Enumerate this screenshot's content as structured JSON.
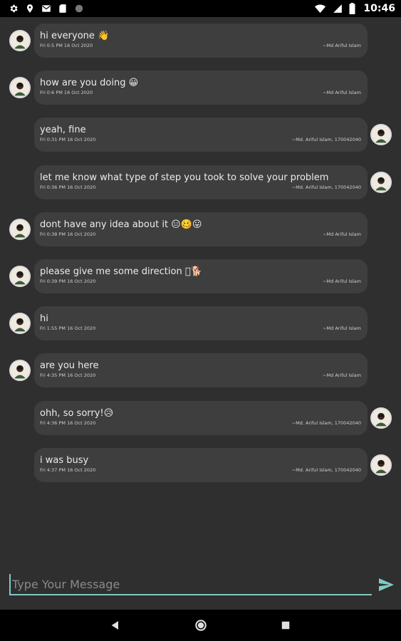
{
  "status_bar": {
    "time": "10:46",
    "left_icons": [
      "gear-icon",
      "location-pin-icon",
      "mail-icon",
      "sd-card-icon",
      "circle-icon"
    ],
    "right_icons": [
      "wifi-icon",
      "signal-icon",
      "battery-icon"
    ]
  },
  "messages": [
    {
      "side": "left",
      "text": "hi everyone 👋",
      "time": "Fri 0:5 PM 16 Oct 2020",
      "sender": "~Md Ariful Islam"
    },
    {
      "side": "left",
      "text": "how are you doing 😀",
      "time": "Fri 0:6 PM 16 Oct 2020",
      "sender": "~Md Ariful Islam"
    },
    {
      "side": "right",
      "text": "yeah, fine",
      "time": "Fri 0:31 PM 16 Oct 2020",
      "sender": "~Md. Ariful Islam, 170042040"
    },
    {
      "side": "right",
      "text": "let me know what type of step you took to solve your problem",
      "time": "Fri 0:36 PM 16 Oct 2020",
      "sender": "~Md. Ariful Islam, 170042040"
    },
    {
      "side": "left",
      "text": " dont have any idea about it 😑🥴😛",
      "time": "Fri 0:38 PM 16 Oct 2020",
      "sender": "~Md Ariful Islam"
    },
    {
      "side": "left",
      "text": "please give me some direction 🏾🐕",
      "time": "Fri 0:39 PM 16 Oct 2020",
      "sender": "~Md Ariful Islam"
    },
    {
      "side": "left",
      "text": "hi",
      "time": "Fri 1:55 PM 16 Oct 2020",
      "sender": "~Md Ariful Islam"
    },
    {
      "side": "left",
      "text": "are you here",
      "time": "Fri 4:35 PM 16 Oct 2020",
      "sender": "~Md Ariful Islam"
    },
    {
      "side": "right",
      "text": "ohh, so sorry!😥",
      "time": "Fri 4:36 PM 16 Oct 2020",
      "sender": "~Md. Ariful Islam, 170042040"
    },
    {
      "side": "right",
      "text": "i was busy",
      "time": "Fri 4:37 PM 16 Oct 2020",
      "sender": "~Md. Ariful Islam, 170042040"
    }
  ],
  "composer": {
    "placeholder": "Type Your Message",
    "value": "",
    "send_icon": "send-icon"
  },
  "nav_bar": {
    "icons": [
      "back-icon",
      "home-icon",
      "recents-icon"
    ]
  },
  "colors": {
    "background": "#2f2f2f",
    "bubble": "#3e3e3e",
    "accent": "#80cbc4"
  }
}
